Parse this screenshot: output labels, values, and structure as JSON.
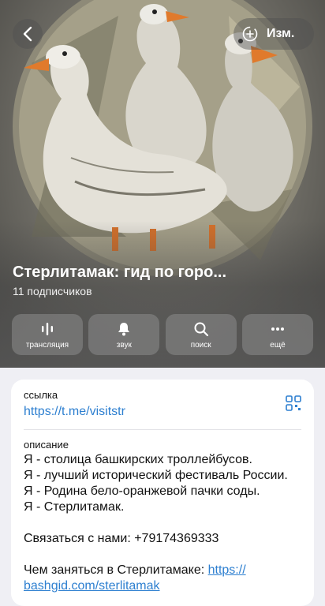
{
  "header": {
    "edit_label": "Изм.",
    "title": "Стерлитамак: гид по горо...",
    "subscribers": "11 подписчиков",
    "icons": {
      "back": "chevron-left-icon",
      "add": "circle-plus-icon"
    }
  },
  "actions": [
    {
      "label": "трансляция",
      "icon": "broadcast-bars-icon"
    },
    {
      "label": "звук",
      "icon": "bell-icon"
    },
    {
      "label": "поиск",
      "icon": "search-icon"
    },
    {
      "label": "ещё",
      "icon": "more-dots-icon"
    }
  ],
  "info": {
    "link_caption": "ссылка",
    "link_value": "https://t.me/visitstr",
    "description_caption": "описание",
    "lines": [
      "Я - столица башкирских троллейбусов.",
      "Я - лучший исторический фестиваль России.",
      "Я - Родина бело-оранжевой пачки соды.",
      "Я - Стерлитамак."
    ],
    "contact": "Связаться с нами: +79174369333",
    "todo_prefix": "Чем заняться в Стерлитамаке: ",
    "todo_link_line1": "https://",
    "todo_link_line2": "bashgid.com/sterlitamak"
  },
  "colors": {
    "accent": "#2d7fd0",
    "page_bg": "#efeff4",
    "card_bg": "#ffffff"
  }
}
